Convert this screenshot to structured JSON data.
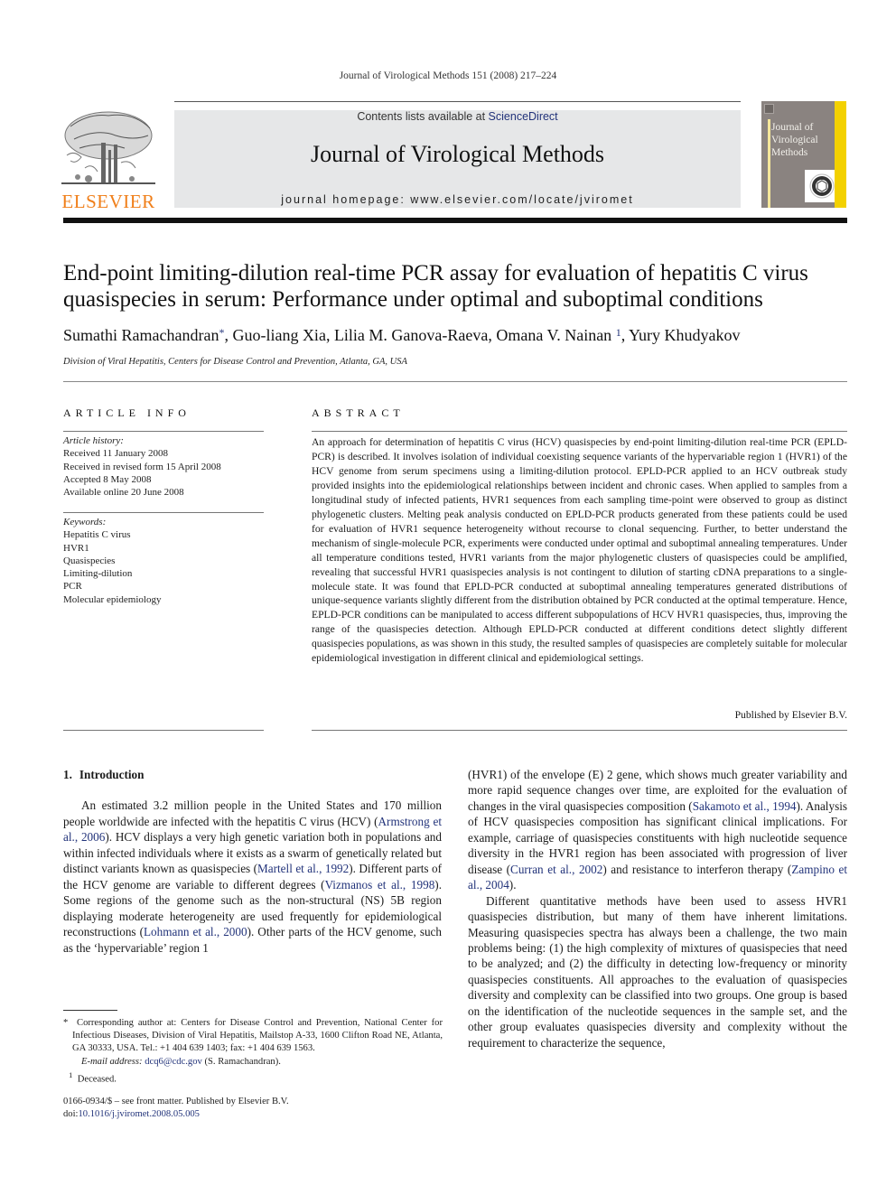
{
  "running_head": "Journal of Virological Methods 151 (2008) 217–224",
  "masthead": {
    "publisher_wordmark": "ELSEVIER",
    "contents_prefix": "Contents lists available at ",
    "contents_link": "ScienceDirect",
    "journal_name": "Journal of Virological Methods",
    "homepage_line": "journal homepage: www.elsevier.com/locate/jviromet",
    "cover_title": "Journal of Virological Methods",
    "colors": {
      "elsevier_orange": "#f07f1a",
      "masthead_gray": "#e6e7e8",
      "cover_gray": "#8a8380",
      "cover_yellow": "#f3d100",
      "link_blue": "#22337a"
    }
  },
  "article": {
    "title": "End-point limiting-dilution real-time PCR assay for evaluation of hepatitis C virus quasispecies in serum: Performance under optimal and suboptimal conditions",
    "authors": [
      {
        "name": "Sumathi Ramachandran",
        "mark": "*"
      },
      {
        "name": "Guo-liang Xia",
        "mark": ""
      },
      {
        "name": "Lilia M. Ganova-Raeva",
        "mark": ""
      },
      {
        "name": "Omana V. Nainan",
        "mark": "1"
      },
      {
        "name": "Yury Khudyakov",
        "mark": ""
      }
    ],
    "affiliation": "Division of Viral Hepatitis, Centers for Disease Control and Prevention, Atlanta, GA, USA"
  },
  "article_info": {
    "heading": "ARTICLE INFO",
    "history_label": "Article history:",
    "history": [
      "Received 11 January 2008",
      "Received in revised form 15 April 2008",
      "Accepted 8 May 2008",
      "Available online 20 June 2008"
    ],
    "keywords_label": "Keywords:",
    "keywords": [
      "Hepatitis C virus",
      "HVR1",
      "Quasispecies",
      "Limiting-dilution",
      "PCR",
      "Molecular epidemiology"
    ]
  },
  "abstract": {
    "heading": "ABSTRACT",
    "text": "An approach for determination of hepatitis C virus (HCV) quasispecies by end-point limiting-dilution real-time PCR (EPLD-PCR) is described. It involves isolation of individual coexisting sequence variants of the hypervariable region 1 (HVR1) of the HCV genome from serum specimens using a limiting-dilution protocol. EPLD-PCR applied to an HCV outbreak study provided insights into the epidemiological relationships between incident and chronic cases. When applied to samples from a longitudinal study of infected patients, HVR1 sequences from each sampling time-point were observed to group as distinct phylogenetic clusters. Melting peak analysis conducted on EPLD-PCR products generated from these patients could be used for evaluation of HVR1 sequence heterogeneity without recourse to clonal sequencing. Further, to better understand the mechanism of single-molecule PCR, experiments were conducted under optimal and suboptimal annealing temperatures. Under all temperature conditions tested, HVR1 variants from the major phylogenetic clusters of quasispecies could be amplified, revealing that successful HVR1 quasispecies analysis is not contingent to dilution of starting cDNA preparations to a single-molecule state. It was found that EPLD-PCR conducted at suboptimal annealing temperatures generated distributions of unique-sequence variants slightly different from the distribution obtained by PCR conducted at the optimal temperature. Hence, EPLD-PCR conditions can be manipulated to access different subpopulations of HCV HVR1 quasispecies, thus, improving the range of the quasispecies detection. Although EPLD-PCR conducted at different conditions detect slightly different quasispecies populations, as was shown in this study, the resulted samples of quasispecies are completely suitable for molecular epidemiological investigation in different clinical and epidemiological settings.",
    "publisher_note": "Published by Elsevier B.V."
  },
  "introduction": {
    "number": "1.",
    "heading": "Introduction",
    "p1": [
      {
        "t": "An estimated 3.2 million people in the United States and 170 million people worldwide are infected with the hepatitis C virus (HCV) ("
      },
      {
        "t": "Armstrong et al., 2006",
        "ref": true
      },
      {
        "t": "). HCV displays a very high genetic variation both in populations and within infected individuals where it exists as a swarm of genetically related but distinct variants known as quasispecies ("
      },
      {
        "t": "Martell et al., 1992",
        "ref": true
      },
      {
        "t": "). Different parts of the HCV genome are variable to different degrees ("
      },
      {
        "t": "Vizmanos et al., 1998",
        "ref": true
      },
      {
        "t": "). Some regions of the genome such as the non-structural (NS) 5B region displaying moderate heterogeneity are used frequently for epidemiological reconstructions ("
      },
      {
        "t": "Lohmann et al., 2000",
        "ref": true
      },
      {
        "t": "). Other parts of the HCV genome, such as the ‘hypervariable’ region 1 (HVR1) of the envelope (E) 2 gene, which shows much greater variability and more rapid sequence changes over time, are exploited for the evaluation of changes in the viral quasispecies composition ("
      },
      {
        "t": "Sakamoto et al., 1994",
        "ref": true
      },
      {
        "t": "). Analysis of HCV quasispecies composition has significant clinical implications. For example, carriage of quasispecies constituents with high nucleotide sequence diversity in the HVR1 region has been associated with progression of liver disease ("
      },
      {
        "t": "Curran et al., 2002",
        "ref": true
      },
      {
        "t": ") and resistance to interferon therapy ("
      },
      {
        "t": "Zampino et al., 2004",
        "ref": true
      },
      {
        "t": ")."
      }
    ],
    "p2": "Different quantitative methods have been used to assess HVR1 quasispecies distribution, but many of them have inherent limitations. Measuring quasispecies spectra has always been a challenge, the two main problems being: (1) the high complexity of mixtures of quasispecies that need to be analyzed; and (2) the difficulty in detecting low-frequency or minority quasispecies constituents. All approaches to the evaluation of quasispecies diversity and complexity can be classified into two groups. One group is based on the identification of the nucleotide sequences in the sample set, and the other group evaluates quasispecies diversity and complexity without the requirement to characterize the sequence,"
  },
  "footnotes": {
    "corresponding_mark": "*",
    "corresponding": "Corresponding author at: Centers for Disease Control and Prevention, National Center for Infectious Diseases, Division of Viral Hepatitis, Mailstop A-33, 1600 Clifton Road NE, Atlanta, GA 30333, USA. Tel.: +1 404 639 1403; fax: +1 404 639 1563.",
    "email_label": "E-mail address:",
    "email": "dcq6@cdc.gov",
    "email_owner": "(S. Ramachandran).",
    "deceased_mark": "1",
    "deceased": "Deceased."
  },
  "front_matter": {
    "issn_line": "0166-0934/$ – see front matter. Published by Elsevier B.V.",
    "doi_label": "doi:",
    "doi": "10.1016/j.jviromet.2008.05.005"
  }
}
